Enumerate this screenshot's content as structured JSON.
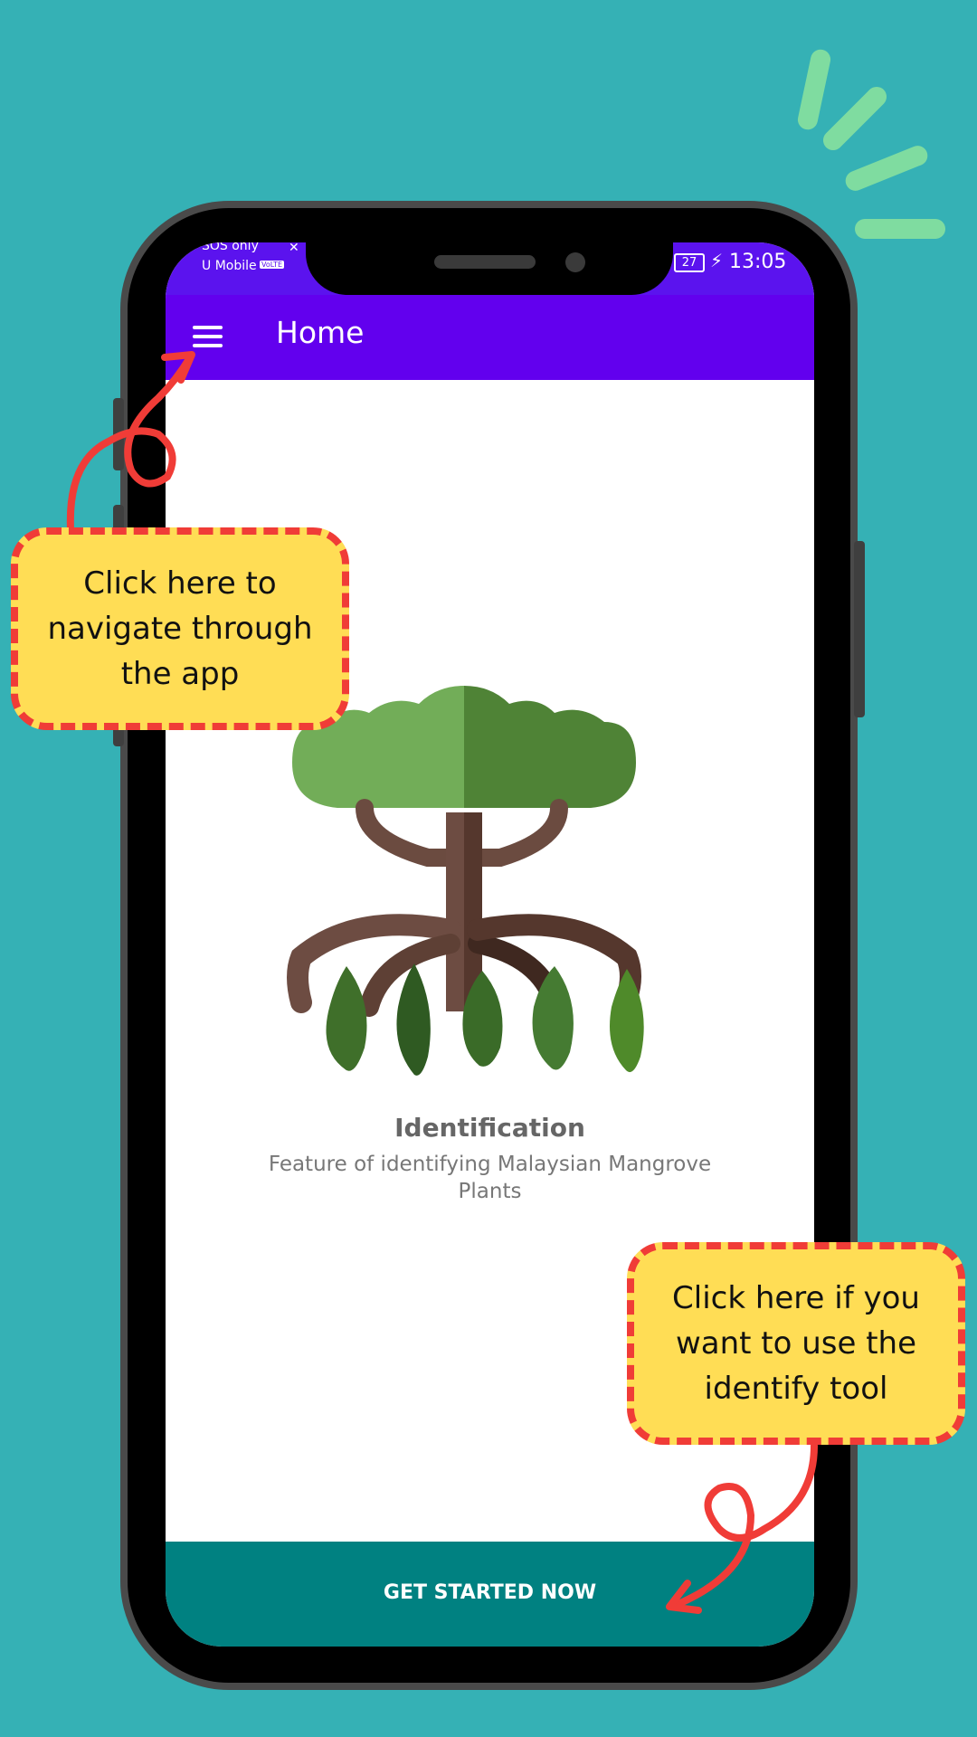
{
  "status_bar": {
    "carrier_line1": "SOS only",
    "carrier_line2": "U Mobile",
    "volte_badge": "VoLTE",
    "battery": "27",
    "time": "13:05"
  },
  "app_bar": {
    "menu_icon": "hamburger-menu-icon",
    "title": "Home"
  },
  "feature": {
    "illustration": "mangrove-tree-with-leaves",
    "title": "Identification",
    "description": "Feature of identifying Malaysian Mangrove Plants"
  },
  "bottom_button": {
    "label": "GET STARTED NOW"
  },
  "callouts": {
    "menu_hint": "Click here to navigate through the app",
    "menu_hint_lines": [
      "Click here to",
      "navigate through",
      "the app"
    ],
    "start_hint": "Click here if you want to use the identify tool",
    "start_hint_lines": [
      "Click here if you",
      "want to use the",
      "identify tool"
    ]
  },
  "colors": {
    "background": "#35b1b5",
    "app_bar": "#6200ee",
    "bottom_button": "#008181",
    "callout_fill": "#ffdd55",
    "callout_border": "#f03c37"
  }
}
